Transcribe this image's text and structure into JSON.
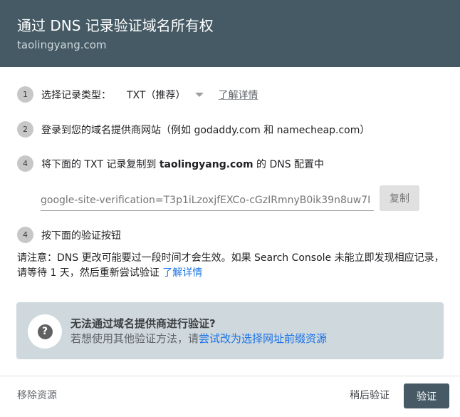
{
  "header": {
    "title": "通过 DNS 记录验证域名所有权",
    "domain": "taolingyang.com"
  },
  "steps": [
    {
      "number": "1",
      "label": "选择记录类型：",
      "select_value": "TXT（推荐）",
      "link": "了解详情"
    },
    {
      "number": "2",
      "text": "登录到您的域名提供商网站（例如 godaddy.com 和 namecheap.com）"
    },
    {
      "number": "4",
      "text_before": "将下面的 TXT 记录复制到 ",
      "domain": "taolingyang.com",
      "text_after": " 的 DNS 配置中"
    },
    {
      "number": "4",
      "text": "按下面的验证按钮"
    }
  ],
  "record": {
    "value": "google-site-verification=T3p1iLzoxjfEXCo-cGzIRmnyB0ik39n8uw7I",
    "copy_label": "复制"
  },
  "note": {
    "text": "请注意：DNS 更改可能要过一段时间才会生效。如果 Search Console 未能立即发现相应记录，请等待 1 天，然后重新尝试验证 ",
    "link": "了解详情"
  },
  "alternative": {
    "icon": "help-icon",
    "title": "无法通过域名提供商进行验证?",
    "text": "若想使用其他验证方法，请",
    "link": "尝试改为选择网址前缀资源"
  },
  "footer": {
    "remove_label": "移除资源",
    "later_label": "稍后验证",
    "verify_label": "验证"
  },
  "colors": {
    "header_bg": "#455a64",
    "accent_link": "#1a73e8",
    "info_box_bg": "#cfd8dc",
    "primary_button": "#455a64"
  }
}
